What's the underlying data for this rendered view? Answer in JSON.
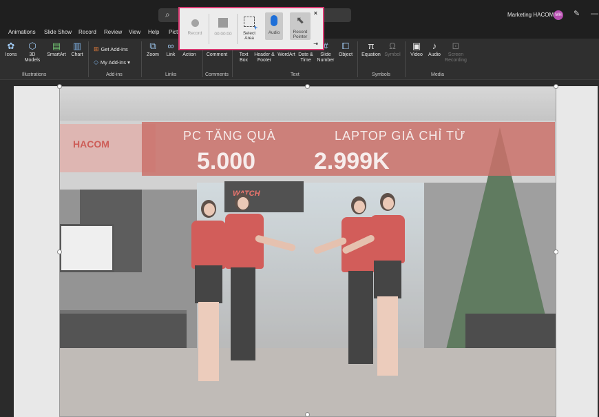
{
  "titlebar": {
    "user_name": "Marketing HACOM",
    "avatar_initials": "MH"
  },
  "tabs": [
    "Animations",
    "Slide Show",
    "Record",
    "Review",
    "View",
    "Help",
    "Pict"
  ],
  "ribbon": {
    "items": {
      "icons": "Icons",
      "models_3d": "3D Models",
      "smartart": "SmartArt",
      "chart": "Chart",
      "get_addins": "Get Add-ins",
      "my_addins": "My Add-ins",
      "zoom": "Zoom",
      "link": "Link",
      "action": "Action",
      "comment": "Comment",
      "text_box": "Text Box",
      "header_footer": "Header & Footer",
      "wordart": "WordArt",
      "date_time": "Date & Time",
      "slide_number": "Slide Number",
      "object": "Object",
      "equation": "Equation",
      "symbol": "Symbol",
      "video": "Video",
      "audio": "Audio",
      "screen_recording": "Screen Recording"
    },
    "groups": {
      "illustrations": "Illustrations",
      "addins": "Add-ins",
      "links": "Links",
      "comments": "Comments",
      "text": "Text",
      "symbols": "Symbols",
      "media": "Media"
    }
  },
  "recorder": {
    "record": "Record",
    "timer": "00:00:00",
    "select_area": "Select Area",
    "audio": "Audio",
    "record_pointer": "Record Pointer",
    "close": "×",
    "pin": "⇥"
  },
  "photo": {
    "banner_text_1": "PC TĂNG QUÀ",
    "banner_text_2": "LAPTOP GIÁ CHỈ TỪ",
    "price_1": "5.000",
    "price_2": "2.999K",
    "store_brand": "HACOM",
    "sign_text": "WATCH"
  },
  "colors": {
    "accent_record_border": "#d83a72",
    "ribbon_bg": "#2f2f2f",
    "title_bg": "#1f1f1f",
    "shirt_red": "#c93a36",
    "avatar_bg": "#b64fb0"
  }
}
